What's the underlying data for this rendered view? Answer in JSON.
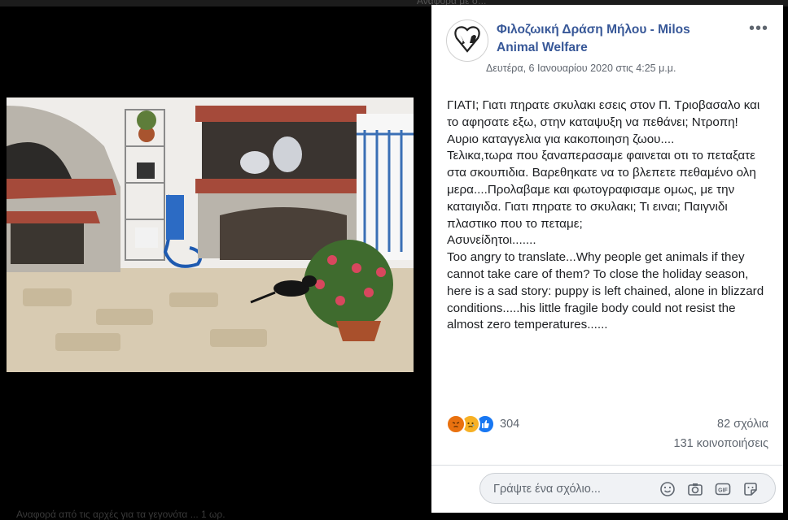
{
  "background_fragments": {
    "top_text": "Αναφορά με σ...",
    "bottom_text": "Αναφορά από τις αρχές για τα γεγονότα ... 1 ωρ."
  },
  "post": {
    "page_name": "Φιλοζωική Δράση Μήλου - Milos Animal Welfare",
    "date": "Δευτέρα, 6 Ιανουαρίου 2020 στις 4:25 μ.μ.",
    "more_icon": "more-options-icon",
    "text": "ΓΙΑΤΙ; Γιατι πηρατε σκυλακι εσεις στον Π. Τριοβασαλο και το αφησατε εξω, στην καταψυξη να πεθάνει; Ντροπη! Αυριο καταγγελια για κακοποιηση ζωου....\nΤελικα,τωρα που ξαναπερασαμε φαινεται οτι το πεταξατε στα σκουπιδια. Βαρεθηκατε να το βλεπετε πεθαμένο ολη μερα....Προλαβαμε και φωτογραφισαμε ομως, με την καταιγιδα. Γιατι πηρατε το σκυλακι; Τι ειναι; Παιγνιδι πλαστικο που το πεταμε;\nΑσυνείδητοι.......\nToo angry to translate...Why people get animals if they cannot take care of them? To close the holiday season, here is a sad story: puppy is left chained, alone in blizzard conditions.....his little fragile body could not resist the almost zero temperatures......"
  },
  "reactions": {
    "types": [
      "angry",
      "sad",
      "like"
    ],
    "colors": {
      "angry": "#e9710f",
      "sad": "#f7b125",
      "like": "#1877f2"
    },
    "count": "304"
  },
  "stats": {
    "comments": "82 σχόλια",
    "shares": "131 κοινοποιήσεις"
  },
  "comment": {
    "placeholder": "Γράψτε ένα σχόλιο...",
    "icons": [
      "emoji-icon",
      "camera-icon",
      "gif-icon",
      "sticker-icon"
    ]
  },
  "colors": {
    "page_name": "#385898",
    "meta_text": "#606770",
    "body_text": "#1c1e21"
  }
}
